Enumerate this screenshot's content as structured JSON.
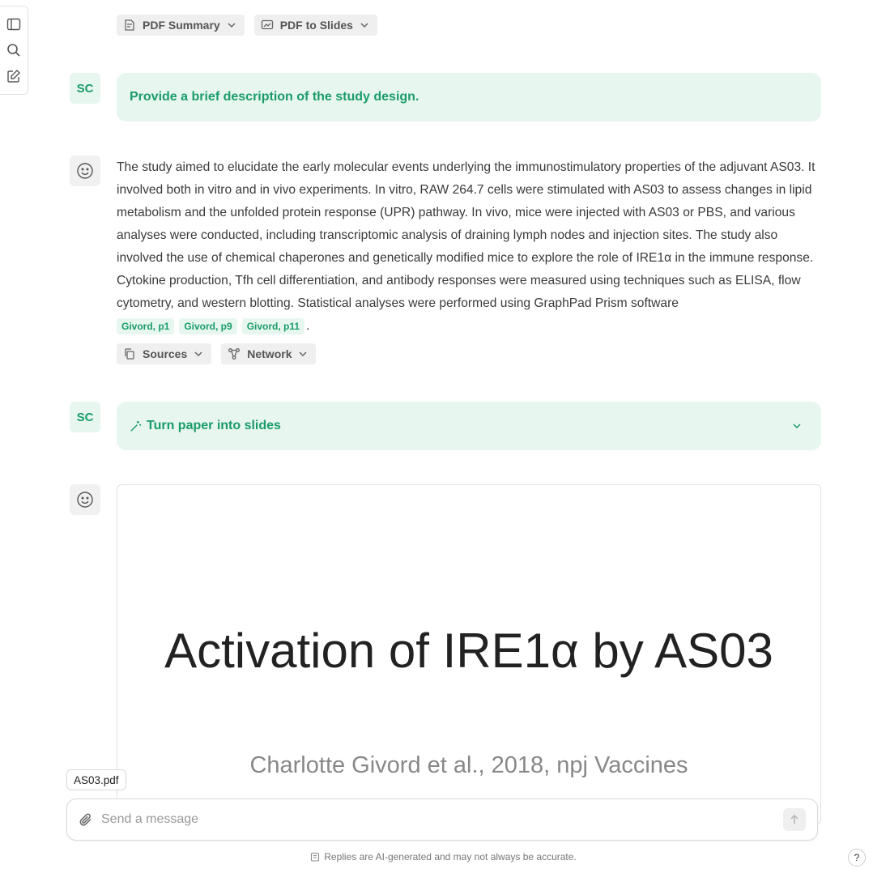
{
  "toolbar": {
    "icons": [
      "sidebar-toggle-icon",
      "search-icon",
      "new-chat-icon"
    ]
  },
  "top_actions": {
    "summary_label": "PDF Summary",
    "slides_label": "PDF to Slides"
  },
  "messages": [
    {
      "role": "user",
      "avatar": "SC",
      "text": "Provide a brief description of the study design."
    },
    {
      "role": "assistant",
      "avatar_icon": "smiley-icon",
      "text": "The study aimed to elucidate the early molecular events underlying the immunostimulatory properties of the adjuvant AS03. It involved both in vitro and in vivo experiments. In vitro, RAW 264.7 cells were stimulated with AS03 to assess changes in lipid metabolism and the unfolded protein response (UPR) pathway. In vivo, mice were injected with AS03 or PBS, and various analyses were conducted, including transcriptomic analysis of draining lymph nodes and injection sites. The study also involved the use of chemical chaperones and genetically modified mice to explore the role of IRE1α in the immune response. Cytokine production, Tfh cell differentiation, and antibody responses were measured using techniques such as ELISA, flow cytometry, and western blotting. Statistical analyses were performed using GraphPad Prism software",
      "citations": [
        "Givord, p1",
        "Givord, p9",
        "Givord, p11"
      ],
      "end_punct": ".",
      "actions": {
        "sources_label": "Sources",
        "network_label": "Network"
      }
    },
    {
      "role": "user",
      "avatar": "SC",
      "text": "Turn paper into slides"
    },
    {
      "role": "assistant",
      "avatar_icon": "smiley-icon",
      "slide": {
        "title": "Activation of IRE1α by AS03",
        "subtitle": "Charlotte Givord et al., 2018, npj Vaccines"
      }
    }
  ],
  "composer": {
    "attached_file": "AS03.pdf",
    "placeholder": "Send a message"
  },
  "footer": {
    "disclaimer": "Replies are AI-generated and may not always be accurate.",
    "help_label": "?"
  },
  "colors": {
    "accent": "#1a9c6a",
    "accent_bg": "#e7f6ef"
  }
}
